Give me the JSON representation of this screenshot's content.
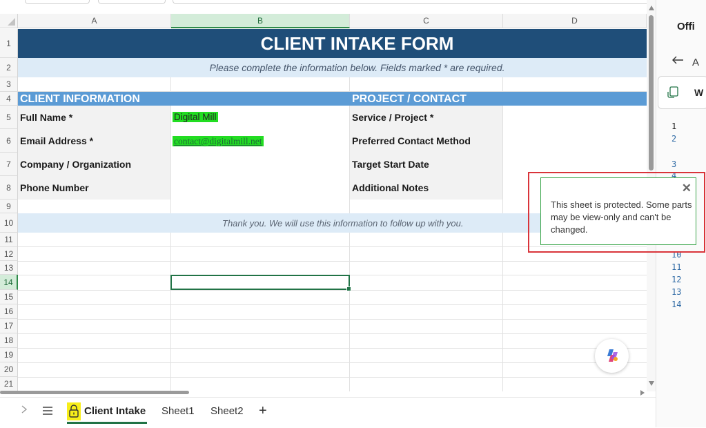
{
  "sheet": {
    "columns": [
      "A",
      "B",
      "C",
      "D"
    ],
    "selected_column": "B",
    "rows": [
      "1",
      "2",
      "3",
      "4",
      "5",
      "6",
      "7",
      "8",
      "9",
      "10",
      "11",
      "12",
      "13",
      "14",
      "15",
      "16",
      "17",
      "18",
      "19",
      "20",
      "21"
    ],
    "selected_row": "14",
    "title": "CLIENT INTAKE FORM",
    "subtitle": "Please complete the information below. Fields marked * are required.",
    "sections": {
      "client": "CLIENT INFORMATION",
      "project": "PROJECT / CONTACT"
    },
    "client_labels": [
      "Full Name *",
      "Email Address *",
      "Company / Organization",
      "Phone Number"
    ],
    "client_values": {
      "full_name": "Digital Mill",
      "email": "contact@digitalmill.net"
    },
    "project_labels": [
      "Service / Project *",
      "Preferred Contact Method",
      "Target Start Date",
      "Additional Notes"
    ],
    "thanks": "Thank you. We will use this information to follow up with you.",
    "colors": {
      "title_band": "#1f4e79",
      "section_band": "#5b9bd5",
      "light_band": "#ddebf7",
      "value_highlight": "#22dd22",
      "accent": "#217346"
    }
  },
  "tabs": {
    "scroll_icon": "chevron-right-icon",
    "menu_icon": "hamburger-icon",
    "lock_icon": "lock-icon",
    "items": [
      "Client Intake",
      "Sheet1",
      "Sheet2"
    ],
    "active": "Client Intake",
    "add_label": "+"
  },
  "side_panel": {
    "title": "Offi",
    "back_icon": "arrow-left-icon",
    "back_letter": "A",
    "card_label": "W",
    "line_numbers": [
      "1",
      "2",
      "3",
      "4",
      "10",
      "11",
      "12",
      "13",
      "14"
    ]
  },
  "toast": {
    "message": "This sheet is protected. Some parts may be view-only and can't be changed.",
    "close_label": "✕"
  },
  "copilot": {
    "icon": "copilot-icon"
  }
}
